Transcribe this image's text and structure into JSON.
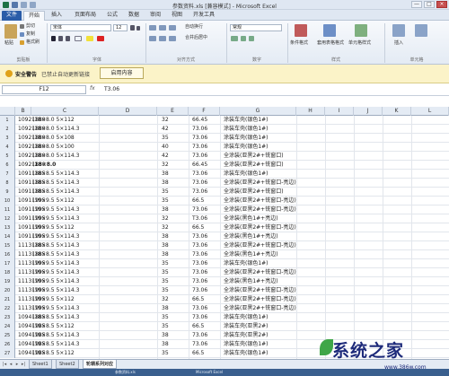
{
  "window": {
    "title": "参数资料.xls [兼容模式] - Microsoft Excel",
    "controls": [
      "—",
      "□",
      "×"
    ]
  },
  "tabs": [
    "文件",
    "开始",
    "插入",
    "页面布局",
    "公式",
    "数据",
    "审阅",
    "视图",
    "开发工具"
  ],
  "ribbon": {
    "paste": "粘贴",
    "cut": "剪切",
    "copy": "复制",
    "format_painter": "格式刷",
    "font_name": "宋体",
    "font_size": "12",
    "wrap_text": "自动换行",
    "merge_center": "合并后居中",
    "number_format": "常规",
    "conditional_format": "条件格式",
    "table_format": "套用表格格式",
    "cell_styles": "单元格样式",
    "insert": "插入",
    "groups": {
      "clipboard": "剪贴板",
      "font": "字体",
      "alignment": "对齐方式",
      "number": "数字",
      "styles": "样式",
      "cells": "单元格"
    }
  },
  "security_bar": {
    "title": "安全警告",
    "message": "已禁止自动更新链接",
    "button": "启用内容"
  },
  "formula_bar": {
    "name_box": "F12",
    "fx": "fx",
    "content": "T3.06"
  },
  "columns": [
    "B",
    "C",
    "D",
    "E",
    "F",
    "G",
    "H",
    "I",
    "J",
    "K",
    "L"
  ],
  "rows": [
    {
      "n": "1",
      "b": "10921880",
      "c": "(18×8.0  5×112",
      "e": "32",
      "f": "66.45",
      "g": "涂装车壳(银色1#)"
    },
    {
      "n": "2",
      "b": "10921880",
      "c": "(18×8.0  5×114.3",
      "e": "42",
      "f": "73.06",
      "g": "涂装车壳(银色1#)"
    },
    {
      "n": "3",
      "b": "10921880",
      "c": "(18×8.0  5×108",
      "e": "35",
      "f": "73.06",
      "g": "涂装车壳(银色1#)"
    },
    {
      "n": "4",
      "b": "10921880",
      "c": "(18×8.0  5×100",
      "e": "40",
      "f": "73.06",
      "g": "涂装车壳(银色1#)"
    },
    {
      "n": "5",
      "b": "10921880",
      "c": "(18×8.0  5×114.3",
      "e": "42",
      "f": "73.06",
      "g": "全涂装(亚黑2#+铣窗口)"
    },
    {
      "n": "6",
      "b": "10921880",
      "c": "(18×8.0",
      "e": "32",
      "f": "66.45",
      "g": "全涂装(亚黑2#+铣窗口)"
    },
    {
      "n": "7",
      "b": "10911885",
      "c": "(18×8.5  5×114.3",
      "e": "38",
      "f": "73.06",
      "g": "涂装车壳(银色1#)"
    },
    {
      "n": "8",
      "b": "10911885",
      "c": "(18×8.5  5×114.3",
      "e": "38",
      "f": "73.06",
      "g": "全涂装(亚黑2#+铣窗口-亮边)"
    },
    {
      "n": "9",
      "b": "10911885",
      "c": "(18×8.5  5×114.3",
      "e": "35",
      "f": "73.06",
      "g": "全涂装(亚黑2#+铣窗口)"
    },
    {
      "n": "10",
      "b": "10911995",
      "c": "(19×9.5  5×112",
      "e": "35",
      "f": "66.5",
      "g": "全涂装(亚黑2#+铣窗口-亮边)"
    },
    {
      "n": "11",
      "b": "10911995",
      "c": "(19×9.5  5×114.3",
      "e": "38",
      "f": "73.06",
      "g": "全涂装(亚黑2#+铣窗口-亮边)"
    },
    {
      "n": "12",
      "b": "10911995",
      "c": "(19×9.5  5×114.3",
      "e": "32",
      "f": "T3.06",
      "g": "全涂装(黑色1#+亮边)"
    },
    {
      "n": "13",
      "b": "10911995",
      "c": "(19×9.5  5×112",
      "e": "32",
      "f": "66.5",
      "g": "全涂装(亚黑2#+铣窗口-亮边)"
    },
    {
      "n": "14",
      "b": "10911995",
      "c": "(19×9.5  5×114.3",
      "e": "38",
      "f": "73.06",
      "g": "全涂装(黑色1#+亮边)"
    },
    {
      "n": "15",
      "b": "11131885",
      "c": "(18×8.5  5×114.3",
      "e": "38",
      "f": "73.06",
      "g": "全涂装(亚黑2#+铣窗口-亮边)"
    },
    {
      "n": "16",
      "b": "11131885",
      "c": "(18×8.5  5×114.3",
      "e": "38",
      "f": "73.06",
      "g": "全涂装(黑色1#+亮边)"
    },
    {
      "n": "17",
      "b": "11131995",
      "c": "(19×9.5  5×114.3",
      "e": "35",
      "f": "73.06",
      "g": "涂装车壳(银色1#)"
    },
    {
      "n": "18",
      "b": "11131995",
      "c": "(19×9.5  5×114.3",
      "e": "35",
      "f": "73.06",
      "g": "全涂装(亚黑2#+铣窗口-亮边)"
    },
    {
      "n": "19",
      "b": "11131995",
      "c": "(19×9.5  5×114.3",
      "e": "35",
      "f": "73.06",
      "g": "全涂装(黑色1#+亮边)"
    },
    {
      "n": "20",
      "b": "11131995",
      "c": "(19×9.5  5×114.3",
      "e": "35",
      "f": "73.06",
      "g": "全涂装(亚黑2#+铣窗口-亮边)"
    },
    {
      "n": "21",
      "b": "11131995",
      "c": "(19×9.5  5×112",
      "e": "32",
      "f": "66.5",
      "g": "全涂装(亚黑2#+铣窗口-亮边)"
    },
    {
      "n": "22",
      "b": "11131995",
      "c": "(19×9.5  5×114.3",
      "e": "38",
      "f": "73.06",
      "g": "全涂装(亚黑2#+铣窗口-亮边)"
    },
    {
      "n": "23",
      "b": "10941885",
      "c": "(18×8.5  5×114.3",
      "e": "35",
      "f": "73.06",
      "g": "涂装车壳(银色1#)"
    },
    {
      "n": "24",
      "b": "10941985",
      "c": "(19×8.5  5×112",
      "e": "35",
      "f": "66.5",
      "g": "涂装车壳(亚黑2#)"
    },
    {
      "n": "25",
      "b": "10941985",
      "c": "(19×8.5  5×114.3",
      "e": "38",
      "f": "73.06",
      "g": "涂装车壳(亚黑2#)"
    },
    {
      "n": "26",
      "b": "10941985",
      "c": "(19×8.5  5×114.3",
      "e": "38",
      "f": "73.06",
      "g": "涂装车壳(银色1#)"
    },
    {
      "n": "27",
      "b": "10941985",
      "c": "(19×8.5  5×112",
      "e": "35",
      "f": "66.5",
      "g": "涂装车壳(银色1#)"
    }
  ],
  "selected_row_index": 5,
  "selected_cell_text": "18×8.0",
  "sheets": [
    "Sheet1",
    "Sheet2",
    "轮辋系列对应"
  ],
  "active_sheet": 2,
  "taskbar": [
    "参数资料.xls",
    "Microsoft Excel"
  ],
  "watermark": {
    "text": "系统之家",
    "url": "www.386w.com"
  },
  "colors": {
    "file_tab": "#2a5ca8",
    "ribbon_bg": "#e4ebf4",
    "header_bg": "#e4ebf4",
    "message_bar": "#fbf3c8",
    "watermark": "#1d2a7a"
  }
}
